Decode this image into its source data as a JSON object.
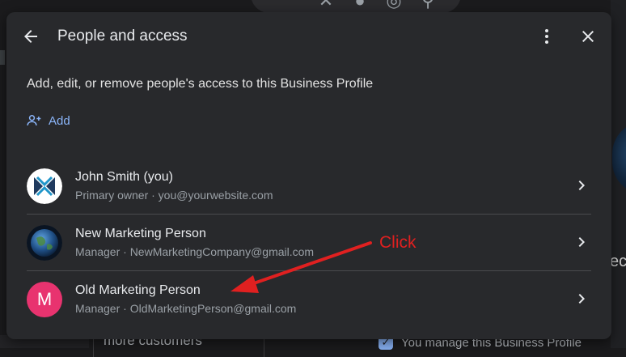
{
  "dialog": {
    "title": "People and access",
    "description": "Add, edit, or remove people's access to this Business Profile",
    "add_label": "Add"
  },
  "people": [
    {
      "name": "John Smith (you)",
      "detail": "Primary owner · you@yourwebsite.com",
      "avatar": "logo-avatar"
    },
    {
      "name": "New Marketing Person",
      "detail": "Manager · NewMarketingCompany@gmail.com",
      "avatar": "globe-avatar"
    },
    {
      "name": "Old Marketing Person",
      "detail": "Manager · OldMarketingPerson@gmail.com",
      "avatar": "letter-avatar",
      "avatar_letter": "M",
      "avatar_color": "#e8336f"
    }
  ],
  "annotation": {
    "text": "Click",
    "color": "#e02020"
  },
  "background": {
    "card_text": "more customers",
    "manage_text": "You manage this Business Profile",
    "right_text": "ec"
  },
  "colors": {
    "accent": "#8ab4f8",
    "dialog_bg": "#28292c"
  }
}
